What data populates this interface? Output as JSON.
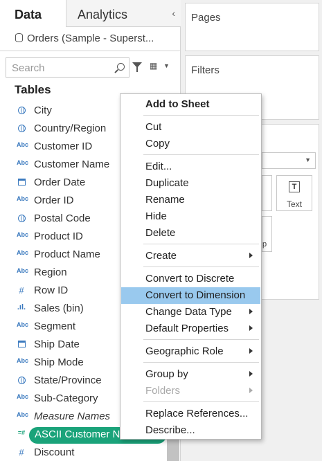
{
  "tabs": {
    "data": "Data",
    "analytics": "Analytics",
    "collapse": "‹"
  },
  "datasource": {
    "name": "Orders (Sample - Superst..."
  },
  "search": {
    "placeholder": "Search"
  },
  "tables_heading": "Tables",
  "fields": [
    {
      "icon": "globe-icon",
      "name": "City"
    },
    {
      "icon": "globe-icon",
      "name": "Country/Region"
    },
    {
      "icon": "Abc",
      "name": "Customer ID"
    },
    {
      "icon": "Abc",
      "name": "Customer Name"
    },
    {
      "icon": "calendar-icon",
      "name": "Order Date"
    },
    {
      "icon": "Abc",
      "name": "Order ID"
    },
    {
      "icon": "globe-icon",
      "name": "Postal Code"
    },
    {
      "icon": "Abc",
      "name": "Product ID"
    },
    {
      "icon": "Abc",
      "name": "Product Name"
    },
    {
      "icon": "Abc",
      "name": "Region"
    },
    {
      "icon": "#",
      "name": "Row ID"
    },
    {
      "icon": "bar-icon",
      "name": "Sales (bin)"
    },
    {
      "icon": "Abc",
      "name": "Segment"
    },
    {
      "icon": "calendar-icon",
      "name": "Ship Date"
    },
    {
      "icon": "Abc",
      "name": "Ship Mode"
    },
    {
      "icon": "globe-icon",
      "name": "State/Province"
    },
    {
      "icon": "Abc",
      "name": "Sub-Category"
    },
    {
      "icon": "Abc",
      "name": "Measure Names"
    },
    {
      "icon": "=#",
      "name": "ASCII Customer N"
    },
    {
      "icon": "#",
      "name": "Discount"
    }
  ],
  "cards": {
    "pages": "Pages",
    "filters": "Filters",
    "text_mark": "Text",
    "partial_label": "p"
  },
  "menu": {
    "add_to_sheet": "Add to Sheet",
    "cut": "Cut",
    "copy": "Copy",
    "edit": "Edit...",
    "duplicate": "Duplicate",
    "rename": "Rename",
    "hide": "Hide",
    "delete": "Delete",
    "create": "Create",
    "convert_discrete": "Convert to Discrete",
    "convert_dimension": "Convert to Dimension",
    "change_type": "Change Data Type",
    "default_props": "Default Properties",
    "geo_role": "Geographic Role",
    "group_by": "Group by",
    "folders": "Folders",
    "replace_refs": "Replace References...",
    "describe": "Describe..."
  },
  "colors": {
    "selected_pill": "#1aa37a",
    "menu_highlight": "#99c9ee",
    "field_icon": "#3b7abf"
  }
}
